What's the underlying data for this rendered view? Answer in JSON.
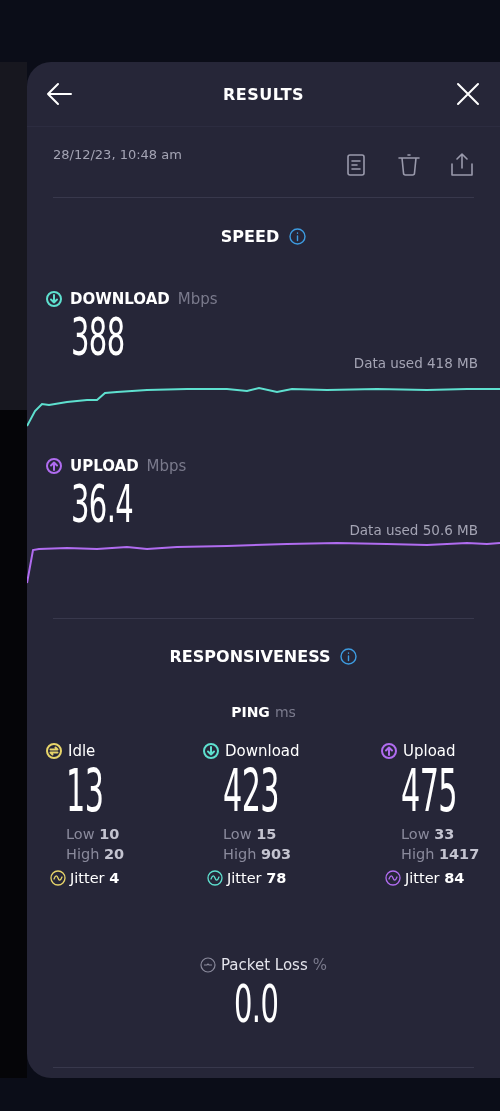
{
  "header": {
    "title": "RESULTS"
  },
  "timestamp": "28/12/23, 10:48 am",
  "speed": {
    "title": "SPEED",
    "tests": [
      {
        "kind": "download",
        "label": "DOWNLOAD",
        "unit": "Mbps",
        "value": "388",
        "data_used": "Data used 418 MB",
        "color": "#5ee0cf"
      },
      {
        "kind": "upload",
        "label": "UPLOAD",
        "unit": "Mbps",
        "value": "36.4",
        "data_used": "Data used 50.6 MB",
        "color": "#b06cf0"
      }
    ]
  },
  "responsiveness": {
    "title": "RESPONSIVENESS",
    "ping": {
      "label": "PING",
      "unit": "ms"
    },
    "columns": [
      {
        "kind": "idle",
        "label": "Idle",
        "value": "13",
        "low": "Low **10**",
        "high": "High **20**",
        "jitter": "Jitter **4**",
        "color": "#e8d56a"
      },
      {
        "kind": "download",
        "label": "Download",
        "value": "423",
        "low": "Low **15**",
        "high": "High **903**",
        "jitter": "Jitter **78**",
        "color": "#5ee0cf"
      },
      {
        "kind": "upload",
        "label": "Upload",
        "value": "475",
        "low": "Low **33**",
        "high": "High **1417**",
        "jitter": "Jitter **84**",
        "color": "#b06cf0"
      }
    ]
  },
  "packet_loss": {
    "label": "Packet Loss",
    "unit": "%",
    "value": "0.0"
  }
}
